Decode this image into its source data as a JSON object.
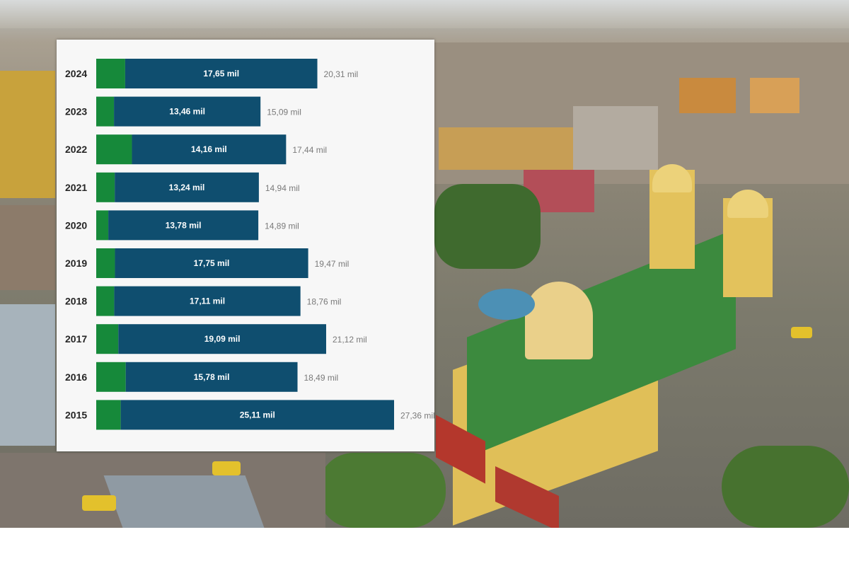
{
  "chart_data": {
    "type": "bar",
    "orientation": "horizontal",
    "stacked": true,
    "categories": [
      "2024",
      "2023",
      "2022",
      "2021",
      "2020",
      "2019",
      "2018",
      "2017",
      "2016",
      "2015"
    ],
    "series": [
      {
        "color": "#0f4e6f",
        "values": [
          17.65,
          13.46,
          14.16,
          13.24,
          13.78,
          17.75,
          17.11,
          19.09,
          15.78,
          25.11
        ]
      },
      {
        "color": "#16893a",
        "values": [
          2.66,
          1.63,
          3.28,
          1.7,
          1.11,
          1.72,
          1.65,
          2.03,
          2.71,
          2.25
        ]
      }
    ],
    "totals": [
      20.31,
      15.09,
      17.44,
      14.94,
      14.89,
      19.47,
      18.76,
      21.12,
      18.49,
      27.36
    ],
    "inner_labels": [
      "17,65 mil",
      "13,46 mil",
      "14,16 mil",
      "13,24 mil",
      "13,78 mil",
      "17,75 mil",
      "17,11 mil",
      "19,09 mil",
      "15,78 mil",
      "25,11 mil"
    ],
    "total_labels": [
      "20,31 mil",
      "15,09 mil",
      "17,44 mil",
      "14,94 mil",
      "14,89 mil",
      "19,47 mil",
      "18,76 mil",
      "21,12 mil",
      "18,49 mil",
      "27,36 mil"
    ],
    "xlim": [
      0,
      27.36
    ],
    "grid": false,
    "legend": "none"
  }
}
